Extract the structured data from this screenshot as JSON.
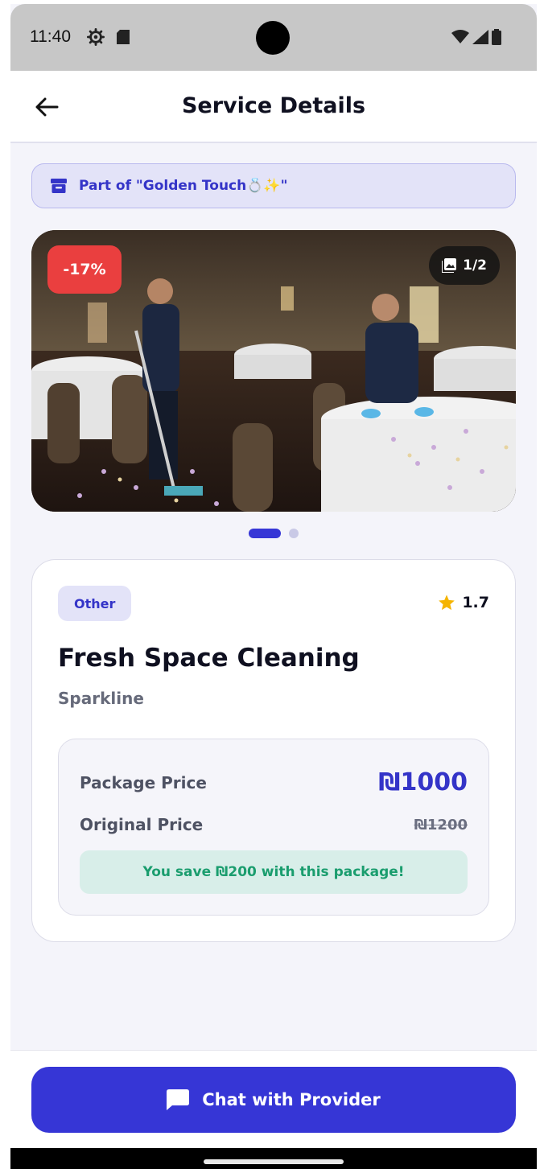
{
  "status_bar": {
    "time": "11:40"
  },
  "header": {
    "title": "Service Details"
  },
  "package_banner": {
    "text": "Part of \"Golden Touch💍✨\""
  },
  "carousel": {
    "discount": "-17%",
    "counter": "1/2"
  },
  "service": {
    "category": "Other",
    "rating": "1.7",
    "title": "Fresh Space Cleaning",
    "provider": "Sparkline"
  },
  "pricing": {
    "package_label": "Package Price",
    "package_value": "₪1000",
    "original_label": "Original Price",
    "original_value": "₪1200",
    "savings_text": "You save ₪200 with this package!"
  },
  "actions": {
    "chat_label": "Chat with Provider"
  },
  "colors": {
    "accent": "#3636d6",
    "discount": "#ea3f3f",
    "savings_text": "#1a9d6e",
    "star": "#f5b400"
  }
}
